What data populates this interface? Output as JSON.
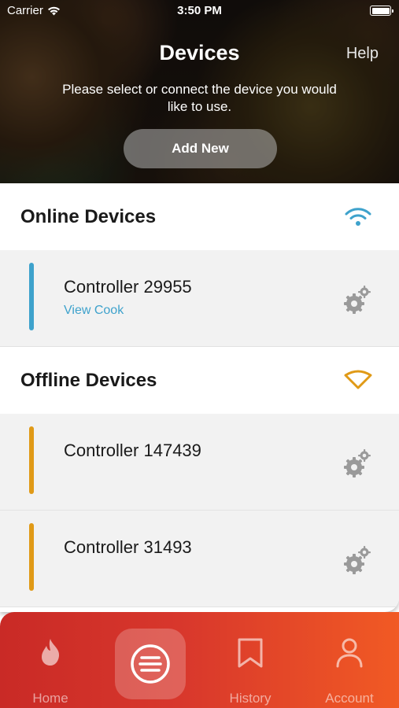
{
  "status_bar": {
    "carrier": "Carrier",
    "time": "3:50 PM"
  },
  "header": {
    "title": "Devices",
    "help_label": "Help",
    "subtitle": "Please select or connect the device you would like to use.",
    "add_new_label": "Add New"
  },
  "sections": {
    "online": {
      "title": "Online Devices",
      "icon": "wifi-icon",
      "accent_color": "#3ea2cc"
    },
    "offline": {
      "title": "Offline Devices",
      "icon": "wifi-off-icon",
      "accent_color": "#e09a17"
    }
  },
  "devices": {
    "online": [
      {
        "name": "Controller 29955",
        "link": "View Cook"
      }
    ],
    "offline": [
      {
        "name": "Controller 147439"
      },
      {
        "name": "Controller 31493"
      }
    ]
  },
  "tabbar": {
    "tabs": [
      {
        "label": "Home",
        "icon": "flame-icon"
      },
      {
        "label": "",
        "icon": "menu-circle-icon",
        "selected": true
      },
      {
        "label": "History",
        "icon": "bookmark-icon"
      },
      {
        "label": "Account",
        "icon": "user-icon"
      }
    ]
  }
}
